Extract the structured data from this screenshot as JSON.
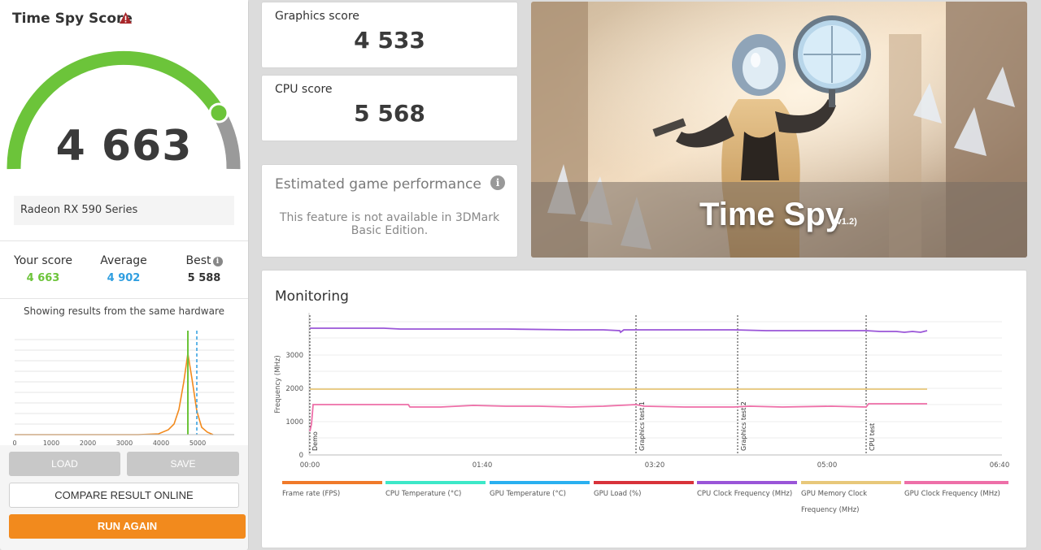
{
  "left": {
    "title": "Time Spy Score",
    "warning_icon": "warning-triangle-icon",
    "score": "4 663",
    "gpu": "Radeon RX 590 Series",
    "stats": {
      "your_label": "Your score",
      "your_value": "4 663",
      "avg_label": "Average",
      "avg_value": "4 902",
      "best_label": "Best",
      "best_value": "5 588",
      "info": "i"
    },
    "hist_caption": "Showing results from the same hardware",
    "hist_ticks": [
      "0",
      "1000",
      "2000",
      "3000",
      "4000",
      "5000"
    ],
    "buttons": {
      "load": "LOAD",
      "save": "SAVE",
      "compare": "COMPARE RESULT ONLINE",
      "run": "RUN AGAIN"
    }
  },
  "graphics": {
    "label": "Graphics score",
    "value": "4 533"
  },
  "cpu": {
    "label": "CPU score",
    "value": "5 568"
  },
  "egp": {
    "title": "Estimated game performance",
    "info": "i",
    "message": "This feature is not available in 3DMark Basic Edition."
  },
  "hero": {
    "title": "Time Spy",
    "version": "(v1.2)"
  },
  "monitoring": {
    "title": "Monitoring",
    "ylabel": "Frequency (MHz)",
    "yticks": [
      "0",
      "1000",
      "2000",
      "3000"
    ],
    "xticks": [
      "00:00",
      "01:40",
      "03:20",
      "05:00",
      "06:40"
    ],
    "markers": [
      "Demo",
      "Graphics test 1",
      "Graphics test 2",
      "CPU test"
    ],
    "legend": [
      {
        "label": "Frame rate (FPS)",
        "color": "#f07a2a"
      },
      {
        "label": "CPU Temperature (°C)",
        "color": "#3de8c8"
      },
      {
        "label": "GPU Temperature (°C)",
        "color": "#2ab0f0"
      },
      {
        "label": "GPU Load (%)",
        "color": "#d8323a"
      },
      {
        "label": "CPU Clock Frequency (MHz)",
        "color": "#9a55d8"
      },
      {
        "label": "GPU Memory Clock Frequency (MHz)",
        "color": "#e8c87a"
      },
      {
        "label": "GPU Clock Frequency (MHz)",
        "color": "#ee6fa8"
      }
    ]
  },
  "colors": {
    "accent_green": "#6cc43a",
    "average_blue": "#2f9ee0",
    "run_orange": "#f28a1d"
  }
}
